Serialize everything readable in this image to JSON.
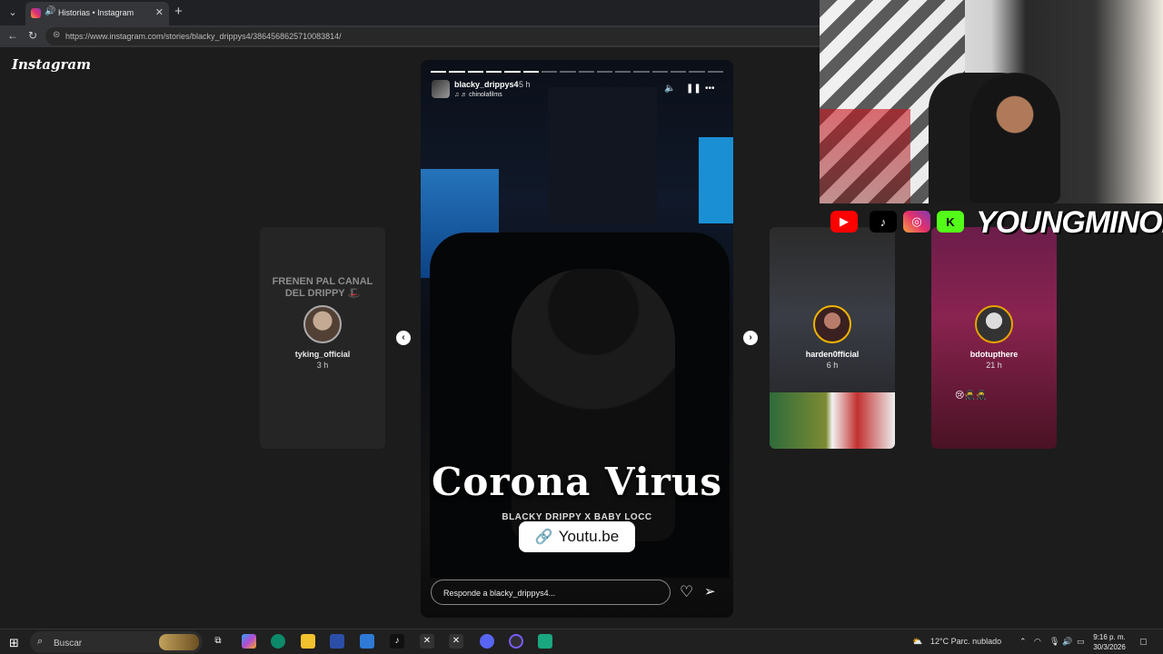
{
  "browser": {
    "tab_title": "Historias • Instagram",
    "url": "https://www.instagram.com/stories/blacky_drippys4/3864568625710083814/"
  },
  "instagram": {
    "logo": "Instagram",
    "main_story": {
      "username": "blacky_drippys4",
      "time": "5 h",
      "audio_credit": "chinolafilms",
      "title_art": "Corona Virus",
      "subtitle_art": "BLACKY DRIPPY X BABY LOCC",
      "link_label": "Youtu.be",
      "reply_placeholder": "Responde a blacky_drippys4...",
      "progress_total": 16,
      "progress_done": 6
    },
    "side_stories": [
      {
        "username": "tyking_official",
        "time": "3 h",
        "overlay": "FRENEN PAL CANAL DEL DRIPPY 🎩"
      },
      {
        "username": "harden0fficial",
        "time": "6 h"
      },
      {
        "username": "bdotupthere",
        "time": "21 h",
        "emojis": "😢🥷🥷"
      }
    ]
  },
  "overlay": {
    "brand_name": "YOUNGMINOR",
    "socials": [
      "YouTube",
      "TikTok",
      "Instagram",
      "Kick"
    ]
  },
  "taskbar": {
    "search_placeholder": "Buscar",
    "weather": "12°C  Parc. nublado",
    "time": "9:16 p. m.",
    "date": "30/3/2026"
  }
}
